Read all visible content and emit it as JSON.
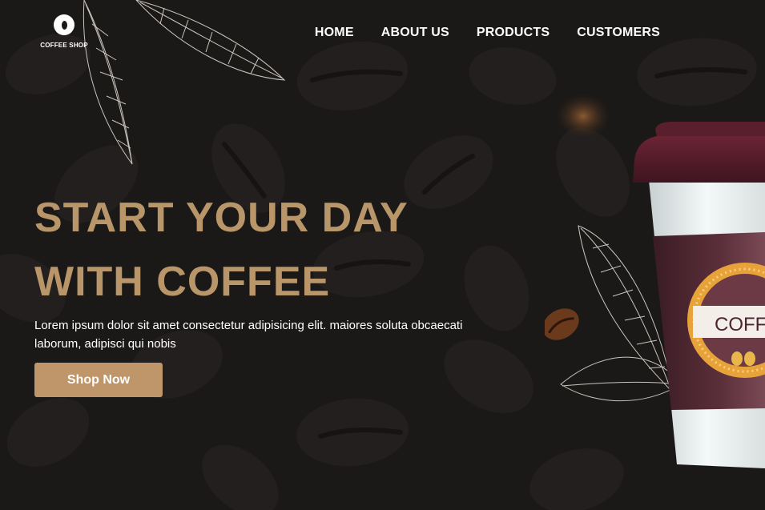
{
  "brand": {
    "name": "COFFEE SHOP"
  },
  "nav": {
    "items": [
      {
        "label": "HOME"
      },
      {
        "label": "ABOUT US"
      },
      {
        "label": "PRODUCTS"
      },
      {
        "label": "CUSTOMERS"
      }
    ]
  },
  "hero": {
    "title_line1": "START YOUR DAY",
    "title_line2": "WITH COFFEE",
    "description": "Lorem ipsum dolor sit amet consectetur adipisicing elit. maiores soluta obcaecati laborum, adipisci qui nobis",
    "cta_label": "Shop Now"
  },
  "cup": {
    "label": "COFFEE"
  },
  "colors": {
    "background": "#1b1918",
    "accent": "#b99669",
    "button": "#bf9669",
    "cup_sleeve": "#4a2530",
    "cup_lid": "#5a1f2c"
  }
}
